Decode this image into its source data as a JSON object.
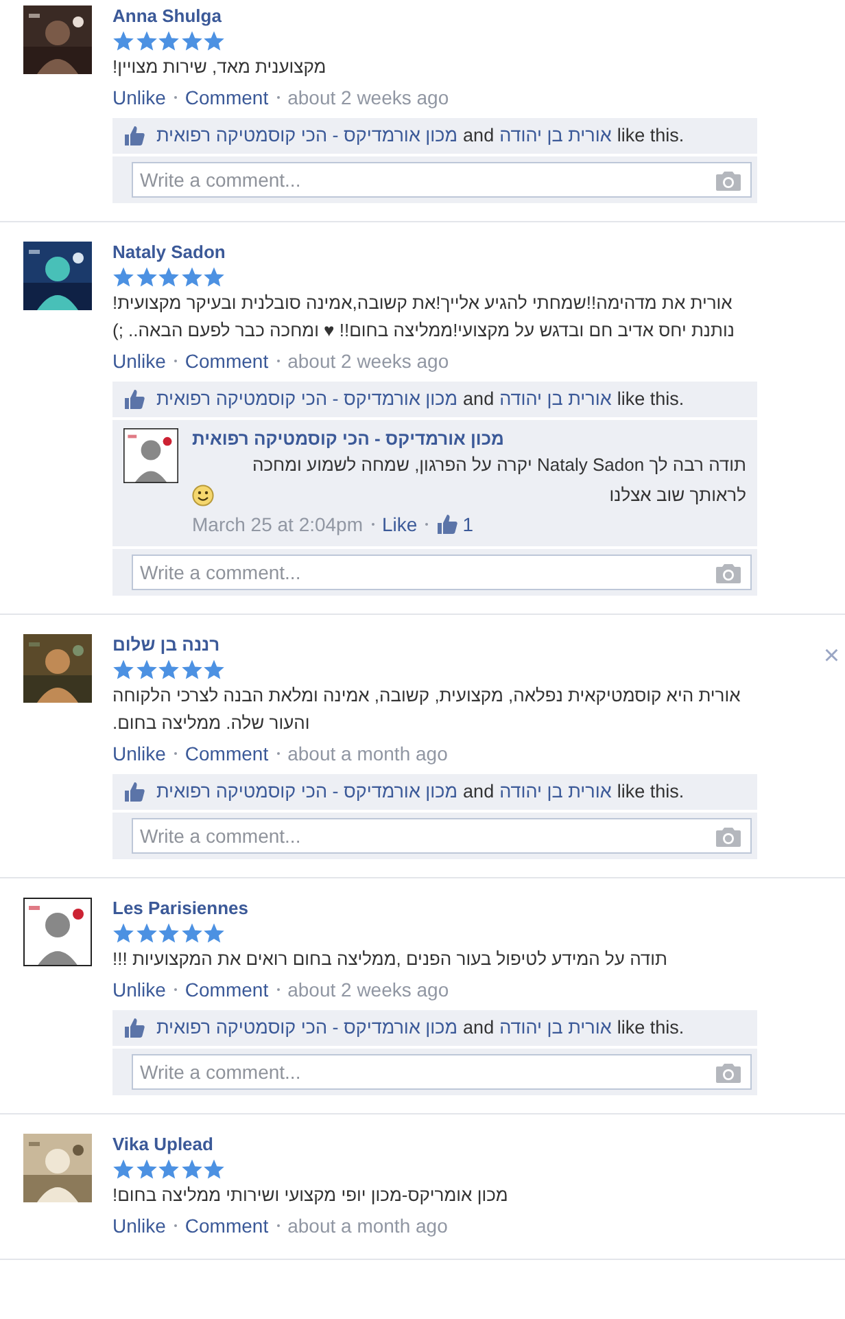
{
  "reviews": [
    {
      "name": "Anna Shulga",
      "stars": 5,
      "text": "מקצוענית מאד, שירות מצויין!",
      "unlike_link": "Unlike",
      "comment_link": "Comment",
      "time": "about 2 weeks ago",
      "likes": {
        "page_link": "מכון אורמדיקס - הכי קוסמטיקה רפואית",
        "joiner": "and",
        "person_link": "אורית בן יהודה",
        "suffix": "like this."
      },
      "comment_box": {
        "placeholder": "Write a comment..."
      }
    },
    {
      "name": "Nataly Sadon",
      "stars": 5,
      "text": "אורית את מדהימה!!שמחתי להגיע אלייך!את קשובה,אמינה סובלנית ובעיקר מקצועית!נותנת יחס אדיב חם ובדגש על מקצועי!ממליצה בחום!! ♥ ומחכה כבר לפעם הבאה.. ;)",
      "unlike_link": "Unlike",
      "comment_link": "Comment",
      "time": "about 2 weeks ago",
      "likes": {
        "page_link": "מכון אורמדיקס - הכי קוסמטיקה רפואית",
        "joiner": "and",
        "person_link": "אורית בן יהודה",
        "suffix": "like this."
      },
      "replies": [
        {
          "name": "מכון אורמדיקס - הכי קוסמטיקה רפואית",
          "text": "תודה רבה לך Nataly Sadon יקרה על הפרגון, שמחה לשמוע ומחכה לראותך שוב אצלנו",
          "time": "March 25 at 2:04pm",
          "like_link": "Like",
          "like_count": "1"
        }
      ],
      "comment_box": {
        "placeholder": "Write a comment..."
      }
    },
    {
      "name": "רננה בן שלום",
      "stars": 5,
      "text": "אורית היא קוסמטיקאית נפלאה, מקצועית, קשובה, אמינה ומלאת הבנה לצרכי הלקוחה והעור שלה. ממליצה בחום.",
      "close": "×",
      "unlike_link": "Unlike",
      "comment_link": "Comment",
      "time": "about a month ago",
      "likes": {
        "page_link": "מכון אורמדיקס - הכי קוסמטיקה רפואית",
        "joiner": "and",
        "person_link": "אורית בן יהודה",
        "suffix": "like this."
      },
      "comment_box": {
        "placeholder": "Write a comment..."
      }
    },
    {
      "name": "Les Parisiennes",
      "stars": 5,
      "text": "תודה על המידע לטיפול בעור הפנים ,ממליצה בחום רואים את המקצועיות !!!",
      "unlike_link": "Unlike",
      "comment_link": "Comment",
      "time": "about 2 weeks ago",
      "likes": {
        "page_link": "מכון אורמדיקס - הכי קוסמטיקה רפואית",
        "joiner": "and",
        "person_link": "אורית בן יהודה",
        "suffix": "like this."
      },
      "comment_box": {
        "placeholder": "Write a comment..."
      }
    },
    {
      "name": "Vika Uplead",
      "stars": 5,
      "text": "מכון אומריקס-מכון יופי מקצועי ושירותי ממליצה בחום!",
      "unlike_link": "Unlike",
      "comment_link": "Comment",
      "time": "about a month ago"
    }
  ]
}
